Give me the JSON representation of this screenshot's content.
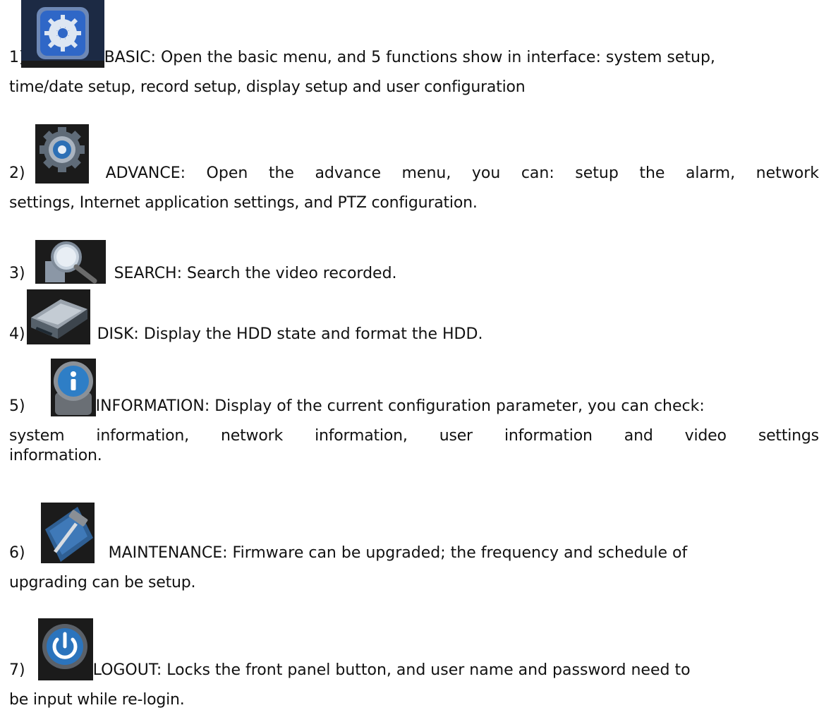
{
  "items": [
    {
      "num": "1)",
      "icon": "gear-tools-icon",
      "line1": "BASIC: Open the basic menu, and 5 functions show in interface: system setup,",
      "line2": "time/date setup, record setup, display setup and user configuration"
    },
    {
      "num": "2)",
      "icon": "gear-icon",
      "line1_words": [
        "ADVANCE:",
        "Open",
        "the",
        "advance",
        "menu,",
        "you",
        "can:",
        "setup",
        "the",
        "alarm,",
        "network"
      ],
      "line2": "settings, Internet application settings, and PTZ configuration."
    },
    {
      "num": "3)",
      "icon": "magnifier-icon",
      "line1": "SEARCH: Search the video recorded."
    },
    {
      "num": "4)",
      "icon": "hard-disk-icon",
      "line1": "DISK: Display the HDD state and format the HDD."
    },
    {
      "num": "5)",
      "icon": "info-icon",
      "line1": "INFORMATION: Display of the current configuration parameter, you can check:",
      "line2_words": [
        "system",
        "information,",
        "network",
        "information,",
        "user",
        "information",
        "and",
        "video",
        "settings"
      ],
      "line3": "information."
    },
    {
      "num": "6)",
      "icon": "hammer-icon",
      "line1": "MAINTENANCE: Firmware can be upgraded; the frequency and schedule of",
      "line2": "upgrading can be setup."
    },
    {
      "num": "7)",
      "icon": "power-icon",
      "line1": "LOGOUT: Locks the front panel button, and user name and password need to",
      "line2": "be input while re-login."
    }
  ]
}
